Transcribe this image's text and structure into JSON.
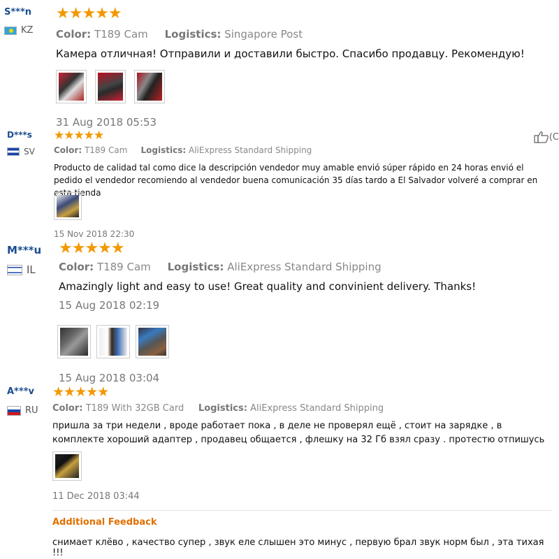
{
  "reviews": [
    {
      "user": "S***n",
      "country": "KZ",
      "rating": "★★★★★",
      "color_label": "Color:",
      "color": "T189 Cam",
      "logistics_label": "Logistics:",
      "logistics": "Singapore Post",
      "text": "Камера отличная! Отправили и доставили быстро. Спасибо продавцу. Рекомендую!",
      "date": "31 Aug 2018 05:53"
    },
    {
      "user": "D***s",
      "country": "SV",
      "rating": "★★★★★",
      "color_label": "Color:",
      "color": "T189 Cam",
      "logistics_label": "Logistics:",
      "logistics": "AliExpress Standard Shipping",
      "text": "Producto de calidad tal como dice la descripción vendedor muy amable envió súper rápido en 24 horas envió el pedido el vendedor recomiendo al vendedor buena comunicación 35 días tardo a El Salvador volveré a comprar en esta tienda",
      "date": "15 Nov 2018 22:30"
    },
    {
      "user": "M***u",
      "country": "IL",
      "rating": "★★★★★",
      "color_label": "Color:",
      "color": "T189 Cam",
      "logistics_label": "Logistics:",
      "logistics": "AliExpress Standard Shipping",
      "text": "Amazingly light and easy to use! Great quality and convinient delivery. Thanks!",
      "date": "15 Aug 2018 02:19",
      "date2": "15 Aug 2018 03:04"
    },
    {
      "user": "A***v",
      "country": "RU",
      "rating": "★★★★★",
      "color_label": "Color:",
      "color": "T189 With 32GB Card",
      "logistics_label": "Logistics:",
      "logistics": "AliExpress Standard Shipping",
      "text": "пришла за три недели , вроде работает пока , в деле не проверял ещё , стоит на зарядке , в комплекте хороший адаптер , продавец общается , флешку на 32 Гб взял сразу . протестю отпишусь",
      "date": "11 Dec 2018 03:44",
      "additional_title": "Additional Feedback",
      "additional_text": "снимает клёво , качество супер , звук еле слышен это минус , первую брал звук норм был , эта тихая !!!"
    }
  ],
  "helpful_count_partial": "(C",
  "colors": {
    "star": "#f39800",
    "user": "#1a4d8f",
    "additional": "#e07000"
  },
  "icons": [
    "thumbs-up-icon",
    "flag-icon"
  ]
}
